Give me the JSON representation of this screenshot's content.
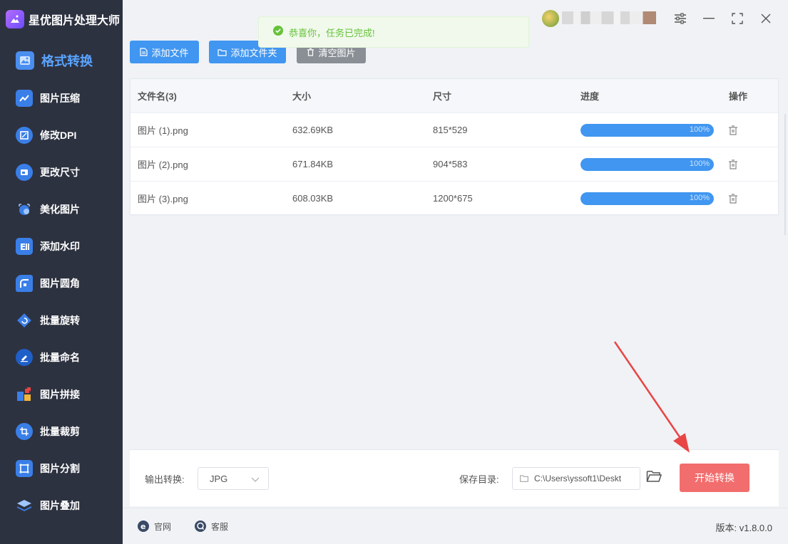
{
  "app": {
    "title": "星优图片处理大师"
  },
  "sidebar": {
    "items": [
      {
        "label": "格式转换",
        "icon": "image-convert-icon",
        "active": true
      },
      {
        "label": "图片压缩",
        "icon": "compress-icon"
      },
      {
        "label": "修改DPI",
        "icon": "dpi-icon"
      },
      {
        "label": "更改尺寸",
        "icon": "resize-icon"
      },
      {
        "label": "美化图片",
        "icon": "beautify-icon"
      },
      {
        "label": "添加水印",
        "icon": "watermark-icon"
      },
      {
        "label": "图片圆角",
        "icon": "rounded-corner-icon"
      },
      {
        "label": "批量旋转",
        "icon": "rotate-icon"
      },
      {
        "label": "批量命名",
        "icon": "rename-icon"
      },
      {
        "label": "图片拼接",
        "icon": "stitch-icon"
      },
      {
        "label": "批量裁剪",
        "icon": "crop-icon"
      },
      {
        "label": "图片分割",
        "icon": "split-icon"
      },
      {
        "label": "图片叠加",
        "icon": "overlay-icon"
      }
    ]
  },
  "toolbar": {
    "add_file": "添加文件",
    "add_folder": "添加文件夹",
    "clear": "清空图片"
  },
  "toast": {
    "message": "恭喜你，任务已完成!"
  },
  "table": {
    "headers": {
      "name": "文件名(3)",
      "size": "大小",
      "dimensions": "尺寸",
      "progress": "进度",
      "action": "操作"
    },
    "rows": [
      {
        "name": "图片 (1).png",
        "size": "632.69KB",
        "dimensions": "815*529",
        "progress": 1.0,
        "progress_text": "100%"
      },
      {
        "name": "图片 (2).png",
        "size": "671.84KB",
        "dimensions": "904*583",
        "progress": 1.0,
        "progress_text": "100%"
      },
      {
        "name": "图片 (3).png",
        "size": "608.03KB",
        "dimensions": "1200*675",
        "progress": 1.0,
        "progress_text": "100%"
      }
    ]
  },
  "bottom": {
    "output_label": "输出转换:",
    "output_format": "JPG",
    "save_label": "保存目录:",
    "save_path": "C:\\Users\\yssoft1\\Deskt",
    "start_button": "开始转换"
  },
  "footer": {
    "website": "官网",
    "support": "客服",
    "version": "版本: v1.8.0.0"
  },
  "colors": {
    "sidebar_bg": "#2d3240",
    "accent_blue": "#4096f0",
    "active_label": "#5aa4ff",
    "start_button": "#f26d6d",
    "toast_text": "#67c23a",
    "arrow": "#e84545"
  }
}
